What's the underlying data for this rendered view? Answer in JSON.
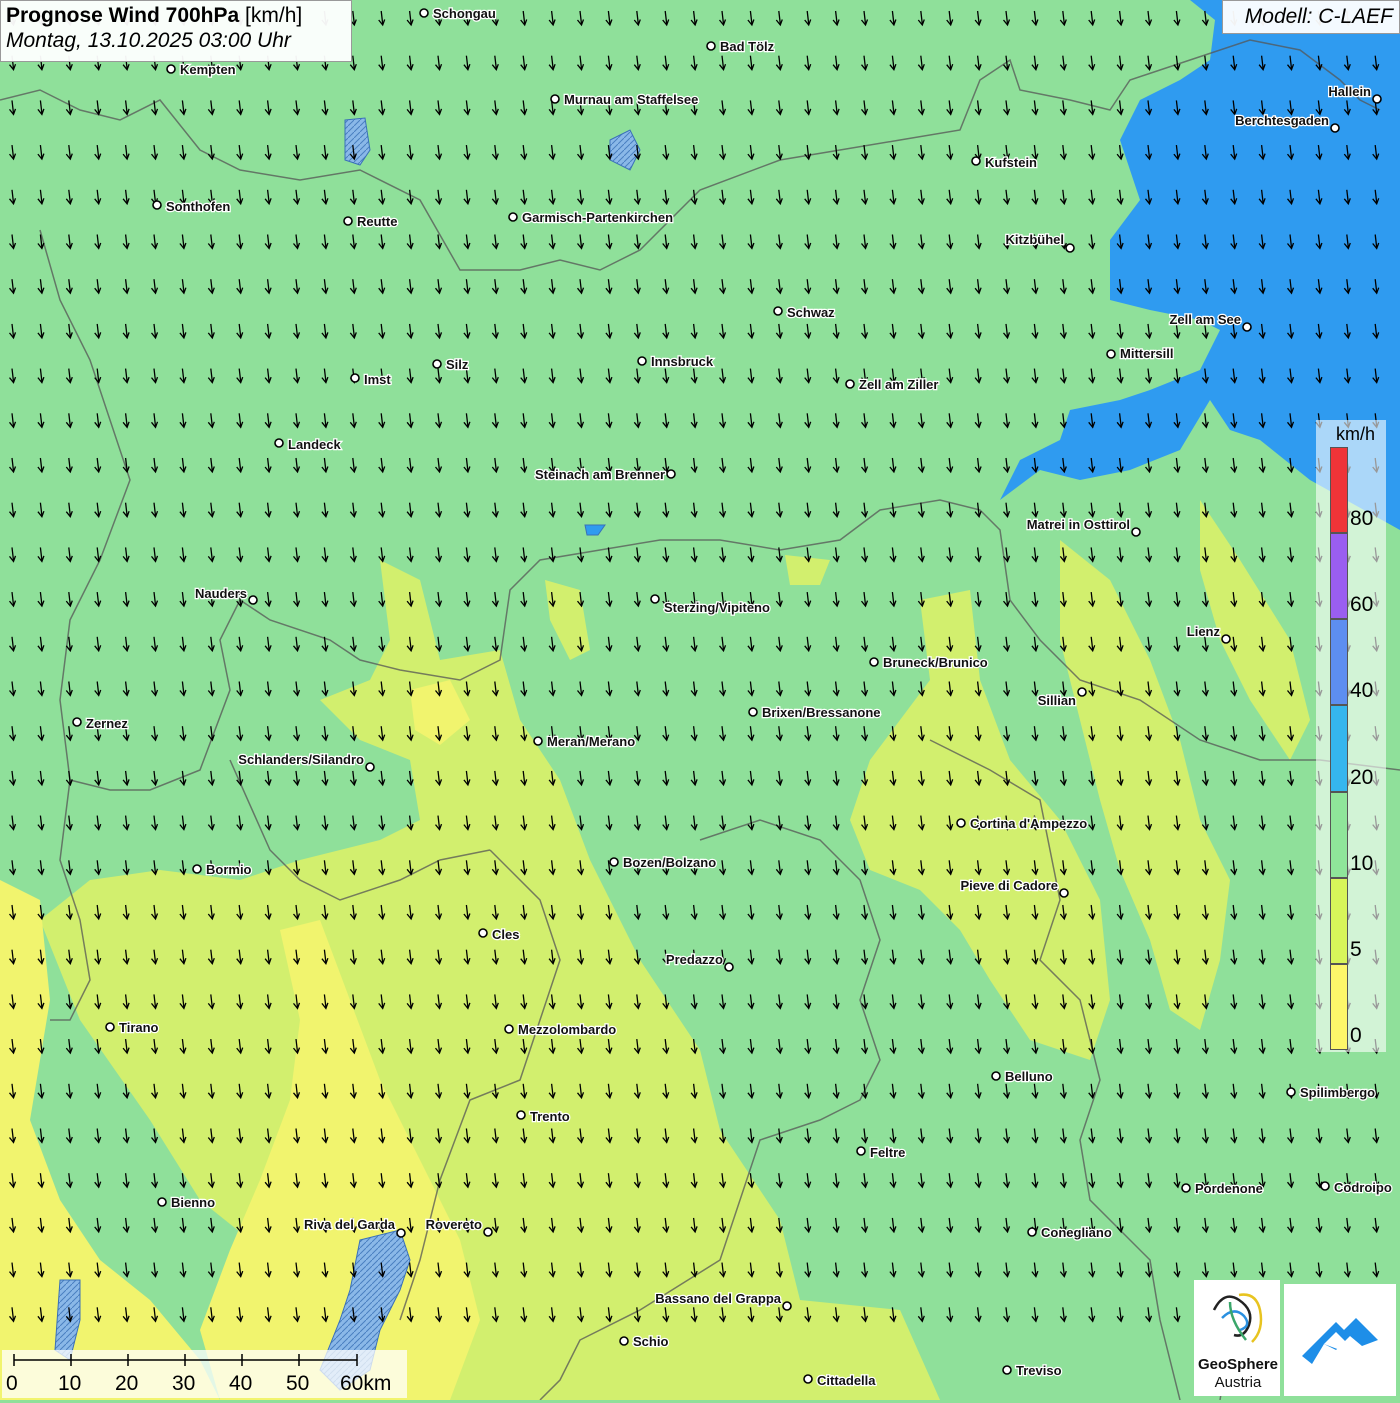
{
  "title": {
    "bold": "Prognose Wind 700hPa",
    "unit": "[km/h]",
    "datetime": "Montag, 13.10.2025 03:00 Uhr"
  },
  "model": "Modell: C-LAEF",
  "legend": {
    "unit": "km/h",
    "levels": [
      {
        "label": "0",
        "color": "#fdf76a"
      },
      {
        "label": "5",
        "color": "#d8f55a"
      },
      {
        "label": "10",
        "color": "#8fe59a"
      },
      {
        "label": "20",
        "color": "#35b6ee"
      },
      {
        "label": "40",
        "color": "#5d8ef0"
      },
      {
        "label": "60",
        "color": "#9a5ef0"
      },
      {
        "label": "80",
        "color": "#ef3438"
      }
    ]
  },
  "scale": {
    "labels": [
      "0",
      "10",
      "20",
      "30",
      "40",
      "50",
      "60km"
    ]
  },
  "logos": {
    "geosphere_name": "GeoSphere",
    "geosphere_sub": "Austria"
  },
  "colors": {
    "background_green": "#8fe09a",
    "yellow_green": "#d2ef6e",
    "yellow": "#f1f46e",
    "blue": "#2f9bf0"
  },
  "wind_direction": "south",
  "cities": [
    {
      "name": "Schongau"
    },
    {
      "name": "Bad Tölz"
    },
    {
      "name": "Kempten"
    },
    {
      "name": "Murnau am Staffelsee"
    },
    {
      "name": "Hallein"
    },
    {
      "name": "Berchtesgaden"
    },
    {
      "name": "Kufstein"
    },
    {
      "name": "Sonthofen"
    },
    {
      "name": "Reutte"
    },
    {
      "name": "Garmisch-Partenkirchen"
    },
    {
      "name": "Kitzbühel"
    },
    {
      "name": "Schwaz"
    },
    {
      "name": "Zell am See"
    },
    {
      "name": "Mittersill"
    },
    {
      "name": "Silz"
    },
    {
      "name": "Innsbruck"
    },
    {
      "name": "Imst"
    },
    {
      "name": "Zell am Ziller"
    },
    {
      "name": "Landeck"
    },
    {
      "name": "Steinach am Brenner"
    },
    {
      "name": "Matrei in Osttirol"
    },
    {
      "name": "Nauders"
    },
    {
      "name": "Sterzing/Vipiteno"
    },
    {
      "name": "Lienz"
    },
    {
      "name": "Bruneck/Brunico"
    },
    {
      "name": "Sillian"
    },
    {
      "name": "Brixen/Bressanone"
    },
    {
      "name": "Zernez"
    },
    {
      "name": "Meran/Merano"
    },
    {
      "name": "Schlanders/Silandro"
    },
    {
      "name": "Cortina d'Ampezzo"
    },
    {
      "name": "Bozen/Bolzano"
    },
    {
      "name": "Bormio"
    },
    {
      "name": "Pieve di Cadore"
    },
    {
      "name": "Cles"
    },
    {
      "name": "Predazzo"
    },
    {
      "name": "Tirano"
    },
    {
      "name": "Mezzolombardo"
    },
    {
      "name": "Belluno"
    },
    {
      "name": "Spilimbergo"
    },
    {
      "name": "Trento"
    },
    {
      "name": "Feltre"
    },
    {
      "name": "Pordenone"
    },
    {
      "name": "Codroipo"
    },
    {
      "name": "Bienno"
    },
    {
      "name": "Riva del Garda"
    },
    {
      "name": "Rovereto"
    },
    {
      "name": "Conegliano"
    },
    {
      "name": "Bassano del Grappa"
    },
    {
      "name": "Schio"
    },
    {
      "name": "Treviso"
    },
    {
      "name": "Cittadella"
    }
  ]
}
